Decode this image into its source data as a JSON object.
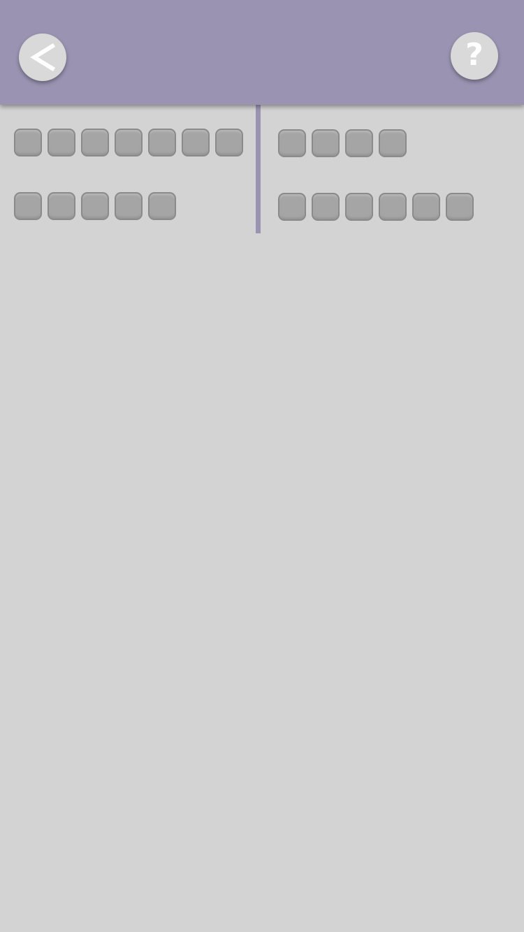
{
  "header": {
    "background_color": "#9a94b2",
    "back_icon": "chevron-left-icon",
    "help_icon": "question-mark-icon",
    "help_glyph": "?"
  },
  "board": {
    "background_color": "#d3d3d3",
    "tile_color": "#a5a5a5",
    "divider_color": "#9a94b2",
    "words": [
      {
        "column": "left",
        "row": 1,
        "length": 7,
        "letters": [
          "",
          "",
          "",
          "",
          "",
          "",
          ""
        ]
      },
      {
        "column": "left",
        "row": 2,
        "length": 5,
        "letters": [
          "",
          "",
          "",
          "",
          ""
        ]
      },
      {
        "column": "right",
        "row": 1,
        "length": 4,
        "letters": [
          "",
          "",
          "",
          ""
        ]
      },
      {
        "column": "right",
        "row": 2,
        "length": 6,
        "letters": [
          "",
          "",
          "",
          "",
          "",
          ""
        ]
      }
    ]
  }
}
